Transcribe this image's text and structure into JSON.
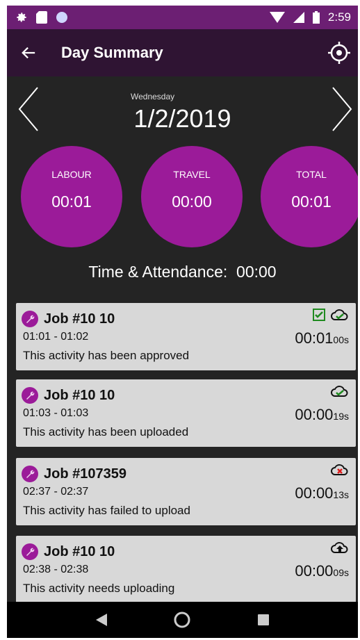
{
  "status_bar": {
    "time": "2:59"
  },
  "app_bar": {
    "title": "Day Summary"
  },
  "day": {
    "weekday": "Wednesday",
    "date": "1/2/2019"
  },
  "summary": [
    {
      "label": "LABOUR",
      "value": "00:01"
    },
    {
      "label": "TRAVEL",
      "value": "00:00"
    },
    {
      "label": "TOTAL",
      "value": "00:01"
    }
  ],
  "time_attendance": {
    "label": "Time & Attendance:",
    "value": "00:00"
  },
  "activities": [
    {
      "title": "Job #10  10",
      "times": "01:01 - 01:02",
      "message": "This activity has been approved",
      "duration": "00:01",
      "seconds": "00s",
      "status": "approved",
      "icons": [
        "checkbox-checked-icon",
        "cloud-check-icon"
      ]
    },
    {
      "title": "Job #10  10",
      "times": "01:03 - 01:03",
      "message": "This activity has been uploaded",
      "duration": "00:00",
      "seconds": "19s",
      "status": "uploaded",
      "icons": [
        "cloud-check-icon"
      ]
    },
    {
      "title": "Job #107359",
      "times": "02:37 - 02:37",
      "message": "This activity has failed to upload",
      "duration": "00:00",
      "seconds": "13s",
      "status": "failed",
      "icons": [
        "cloud-error-icon"
      ]
    },
    {
      "title": "Job #10  10",
      "times": "02:38 - 02:38",
      "message": "This activity needs uploading",
      "duration": "00:00",
      "seconds": "09s",
      "status": "pending",
      "icons": [
        "cloud-upload-icon"
      ]
    }
  ],
  "colors": {
    "accent": "#9b1b99",
    "app_bar": "#2f1433",
    "status_bar": "#6c1f73",
    "background": "#242424",
    "card": "#d8d8d8",
    "success": "#1f8a1f",
    "error": "#e01b1b"
  }
}
